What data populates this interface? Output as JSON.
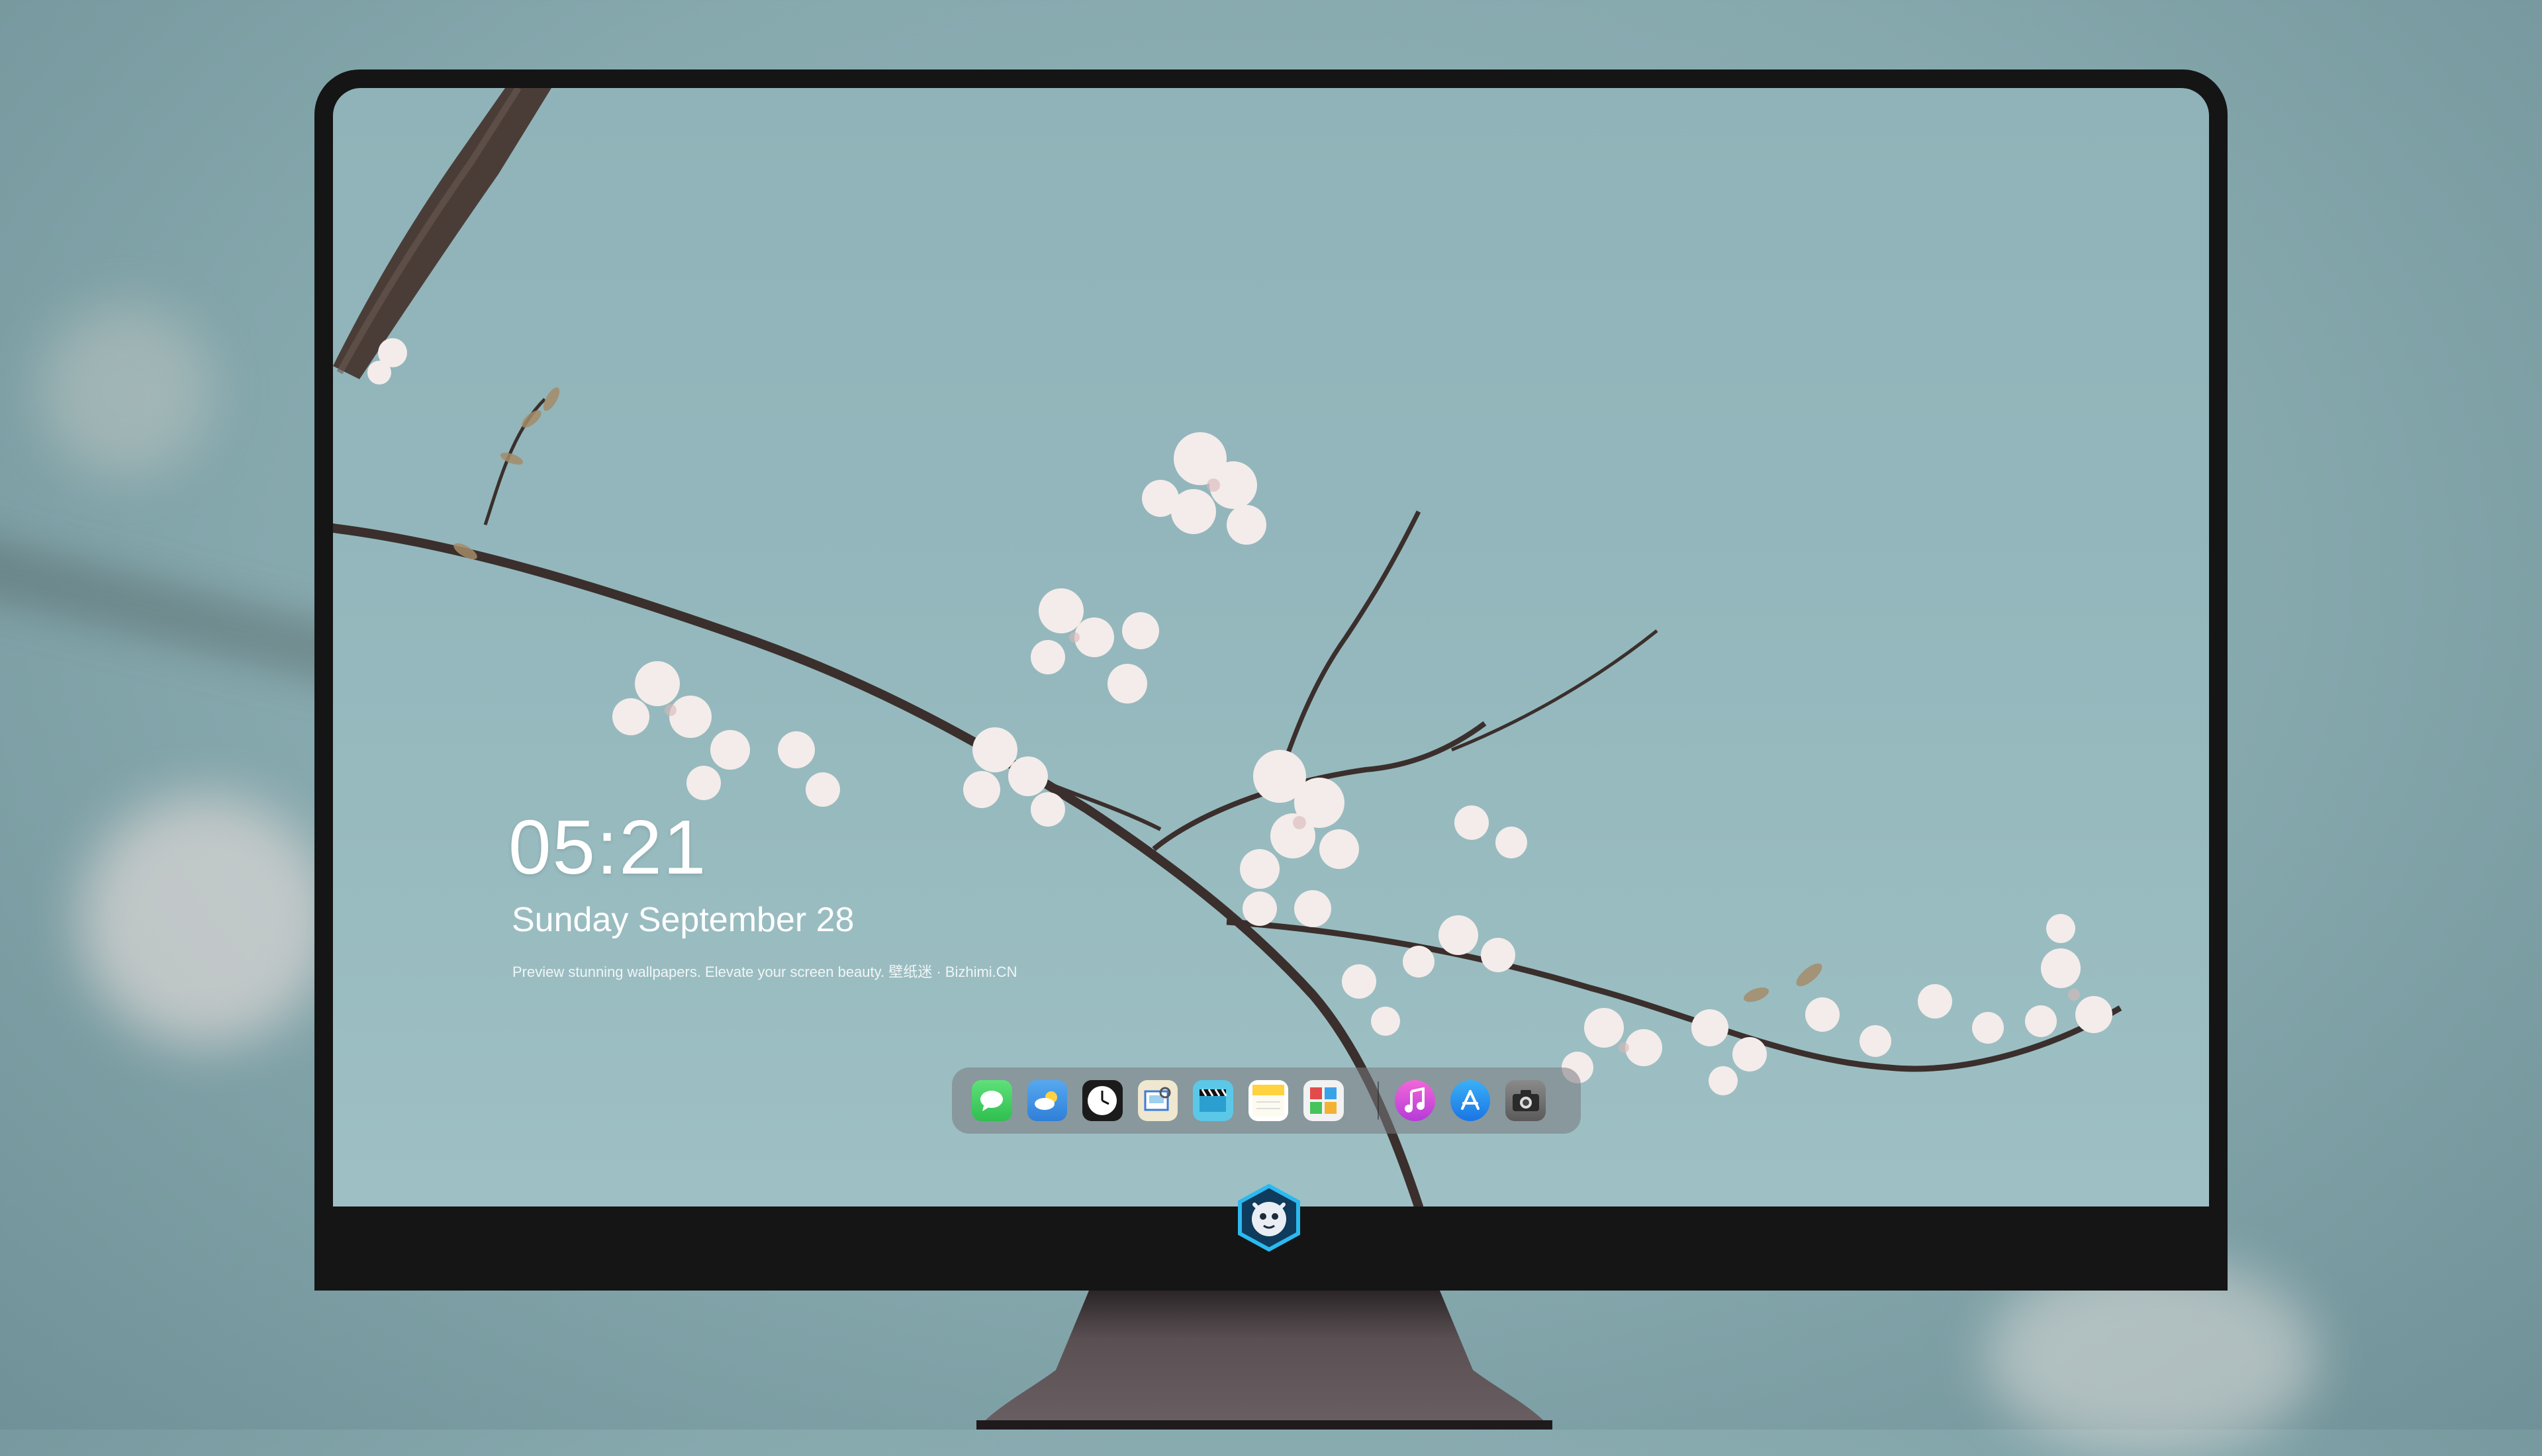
{
  "lockscreen": {
    "time": "05:21",
    "date": "Sunday September  28",
    "caption": "Preview stunning wallpapers. Elevate your screen beauty. 壁纸迷 · Bizhimi.CN"
  },
  "dock": {
    "apps": [
      {
        "name": "Messages",
        "icon": "messages-icon",
        "color": "#34c759"
      },
      {
        "name": "Weather",
        "icon": "weather-icon",
        "color": "#3a8fe6"
      },
      {
        "name": "Clock",
        "icon": "clock-icon",
        "color": "#1c1c1c"
      },
      {
        "name": "Preview",
        "icon": "preview-icon",
        "color": "#e9e3cf"
      },
      {
        "name": "Clips",
        "icon": "clapperboard-icon",
        "color": "#5bc8e8"
      },
      {
        "name": "Notes",
        "icon": "notes-icon",
        "color": "#ffd94a"
      },
      {
        "name": "Photo Booth",
        "icon": "photo-booth-icon",
        "color": "#f0f0f0"
      },
      {
        "name": "iTunes",
        "icon": "music-icon",
        "color": "#e04bd6"
      },
      {
        "name": "App Store",
        "icon": "app-store-icon",
        "color": "#1f8ff2"
      },
      {
        "name": "Camera",
        "icon": "camera-icon",
        "color": "#6e6e6e"
      }
    ]
  },
  "colors": {
    "sky": "#93b7bc",
    "bezel": "#151515",
    "chin": "#413a3d",
    "logo_accent": "#2bb9f0"
  }
}
